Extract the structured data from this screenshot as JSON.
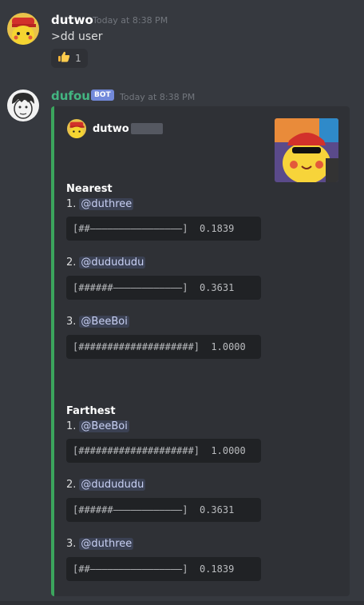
{
  "message1": {
    "username": "dutwo",
    "timestamp": "Today at 8:38 PM",
    "content": ">dd user",
    "reaction": {
      "emoji": "thumbs-up",
      "count": "1"
    }
  },
  "message2": {
    "username": "dufour",
    "username_color": "#43b581",
    "badge": "BOT",
    "timestamp": "Today at 8:38 PM",
    "embed": {
      "accent_color": "#3ba55d",
      "author": "dutwo",
      "nearest": {
        "title": "Nearest",
        "entries": [
          {
            "rank": "1.",
            "mention": "@duthree",
            "bar": "[##————————————————]",
            "score": "0.1839"
          },
          {
            "rank": "2.",
            "mention": "@dudududu",
            "bar": "[######————————————]",
            "score": "0.3631"
          },
          {
            "rank": "3.",
            "mention": "@BeeBoi",
            "bar": "[####################]",
            "score": "1.0000"
          }
        ]
      },
      "farthest": {
        "title": "Farthest",
        "entries": [
          {
            "rank": "1.",
            "mention": "@BeeBoi",
            "bar": "[####################]",
            "score": "1.0000"
          },
          {
            "rank": "2.",
            "mention": "@dudududu",
            "bar": "[######————————————]",
            "score": "0.3631"
          },
          {
            "rank": "3.",
            "mention": "@duthree",
            "bar": "[##————————————————]",
            "score": "0.1839"
          }
        ]
      }
    }
  }
}
